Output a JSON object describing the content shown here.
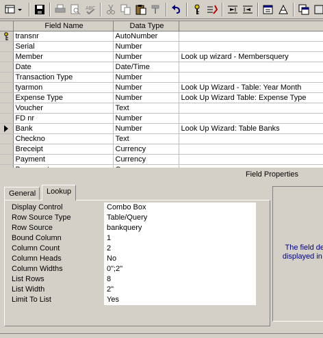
{
  "toolbar": {
    "buttons": [
      {
        "name": "view-icon"
      },
      {
        "name": "save-icon"
      },
      {
        "name": "print-icon"
      },
      {
        "name": "print-preview-icon"
      },
      {
        "name": "spelling-icon"
      },
      {
        "name": "cut-icon"
      },
      {
        "name": "copy-icon"
      },
      {
        "name": "paste-icon"
      },
      {
        "name": "format-painter-icon"
      },
      {
        "name": "undo-icon"
      },
      {
        "name": "primary-key-icon"
      },
      {
        "name": "indexes-icon"
      },
      {
        "name": "insert-rows-icon"
      },
      {
        "name": "delete-rows-icon"
      },
      {
        "name": "properties-icon"
      },
      {
        "name": "build-icon"
      },
      {
        "name": "database-window-icon"
      }
    ]
  },
  "grid": {
    "headers": {
      "field_name": "Field Name",
      "data_type": "Data Type",
      "description": ""
    },
    "rows": [
      {
        "field": "transnr",
        "type": "AutoNumber",
        "desc": "",
        "key": true
      },
      {
        "field": "Serial",
        "type": "Number",
        "desc": ""
      },
      {
        "field": "Member",
        "type": "Number",
        "desc": "Look up wizard - Membersquery"
      },
      {
        "field": "Date",
        "type": "Date/Time",
        "desc": ""
      },
      {
        "field": "Transaction Type",
        "type": "Number",
        "desc": ""
      },
      {
        "field": "tyarmon",
        "type": "Number",
        "desc": "Look Up Wizard - Table: Year Month"
      },
      {
        "field": "Expense Type",
        "type": "Number",
        "desc": "Look Up Wizard  Table: Expense Type"
      },
      {
        "field": "Voucher",
        "type": "Text",
        "desc": ""
      },
      {
        "field": "FD nr",
        "type": "Number",
        "desc": ""
      },
      {
        "field": "Bank",
        "type": "Number",
        "desc": "Look Up Wizard:  Table Banks",
        "current": true
      },
      {
        "field": "Checkno",
        "type": "Text",
        "desc": ""
      },
      {
        "field": "Breceipt",
        "type": "Currency",
        "desc": ""
      },
      {
        "field": "Payment",
        "type": "Currency",
        "desc": ""
      },
      {
        "field": "Bpayment",
        "type": "Currency",
        "desc": ""
      }
    ]
  },
  "field_properties": {
    "title": "Field Properties",
    "tabs": [
      {
        "label": "General"
      },
      {
        "label": "Lookup",
        "active": true
      }
    ],
    "props": [
      {
        "label": "Display Control",
        "value": "Combo Box"
      },
      {
        "label": "Row Source Type",
        "value": "Table/Query"
      },
      {
        "label": "Row Source",
        "value": "bankquery"
      },
      {
        "label": "Bound Column",
        "value": "1"
      },
      {
        "label": "Column Count",
        "value": "2"
      },
      {
        "label": "Column Heads",
        "value": "No"
      },
      {
        "label": "Column Widths",
        "value": "0\";2\""
      },
      {
        "label": "List Rows",
        "value": "8"
      },
      {
        "label": "List Width",
        "value": "2\""
      },
      {
        "label": "Limit To List",
        "value": "Yes"
      }
    ],
    "help_line1": "The field des",
    "help_line2": "displayed in th"
  }
}
